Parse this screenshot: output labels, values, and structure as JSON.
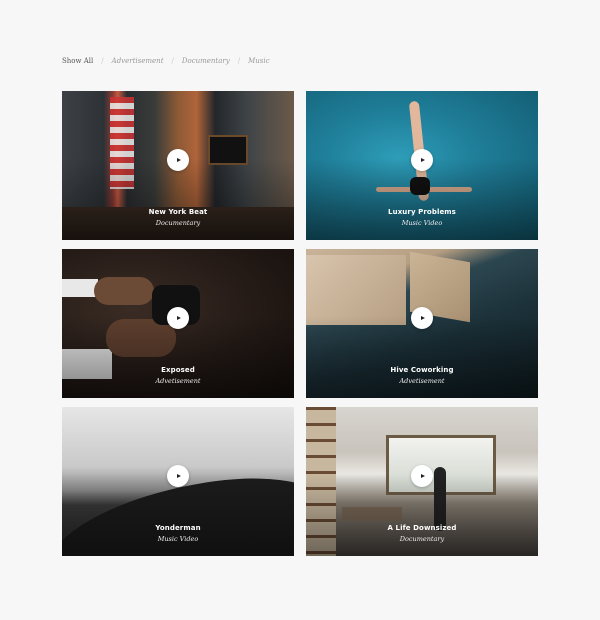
{
  "filters": [
    {
      "label": "Show All",
      "active": true
    },
    {
      "label": "Advertisement",
      "active": false
    },
    {
      "label": "Documentary",
      "active": false
    },
    {
      "label": "Music",
      "active": false
    }
  ],
  "filter_separator": "/",
  "projects": [
    {
      "title": "New York Beat",
      "category": "Documentary"
    },
    {
      "title": "Luxury Problems",
      "category": "Music Video"
    },
    {
      "title": "Exposed",
      "category": "Advetisement"
    },
    {
      "title": "Hive Coworking",
      "category": "Advetisement"
    },
    {
      "title": "Yonderman",
      "category": "Music Video"
    },
    {
      "title": "A Life Downsized",
      "category": "Documentary"
    }
  ],
  "icons": {
    "play": "play-icon"
  },
  "colors": {
    "background": "#f7f7f7",
    "active_filter": "#555555",
    "inactive_filter": "#9a9a9a"
  }
}
